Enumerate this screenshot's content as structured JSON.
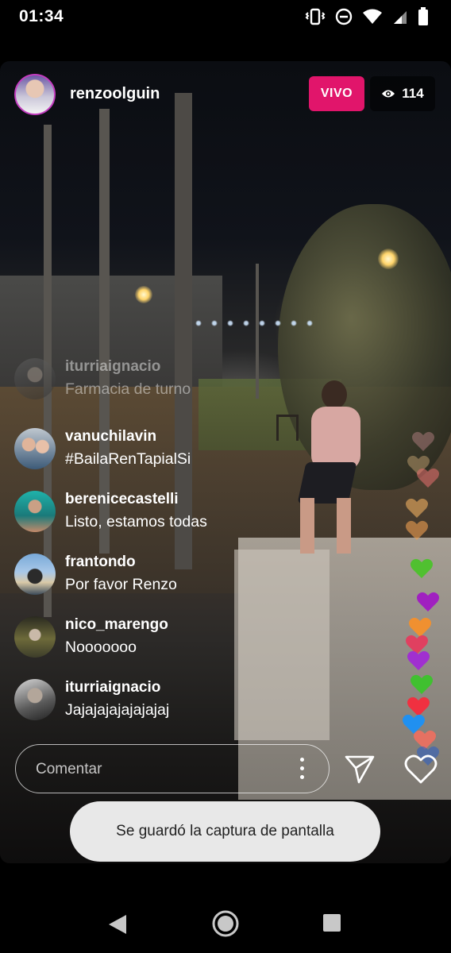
{
  "status_bar": {
    "time": "01:34",
    "icons": [
      "vibrate-icon",
      "do-not-disturb-icon",
      "wifi-icon",
      "signal-icon",
      "battery-icon"
    ]
  },
  "live": {
    "host_username": "renzoolguin",
    "live_badge": "VIVO",
    "viewer_count": "114",
    "accent_color": "#e1156b"
  },
  "comments": [
    {
      "user": "iturriaignacio",
      "text": "Farmacia de turno",
      "faded": true
    },
    {
      "user": "vanuchilavin",
      "text": "#BailaRenTapialSi",
      "faded": false
    },
    {
      "user": "berenicecastelli",
      "text": "Listo, estamos todas",
      "faded": false
    },
    {
      "user": "frantondo",
      "text": "Por favor Renzo",
      "faded": false
    },
    {
      "user": "nico_marengo",
      "text": "Nooooooo",
      "faded": false
    },
    {
      "user": "iturriaignacio",
      "text": "Jajajajajajajajaj",
      "faded": false
    }
  ],
  "composer": {
    "placeholder": "Comentar"
  },
  "floating_heart_colors": [
    "#e8a0a8",
    "#c0a070",
    "#e87070",
    "#f0b060",
    "#f0a050",
    "#50c030",
    "#a020c0",
    "#f09030",
    "#e04060",
    "#a030d0",
    "#40c030",
    "#f03040",
    "#2090f0",
    "#f07060",
    "#3060c0"
  ],
  "toast": {
    "message": "Se guardó la captura de pantalla"
  }
}
